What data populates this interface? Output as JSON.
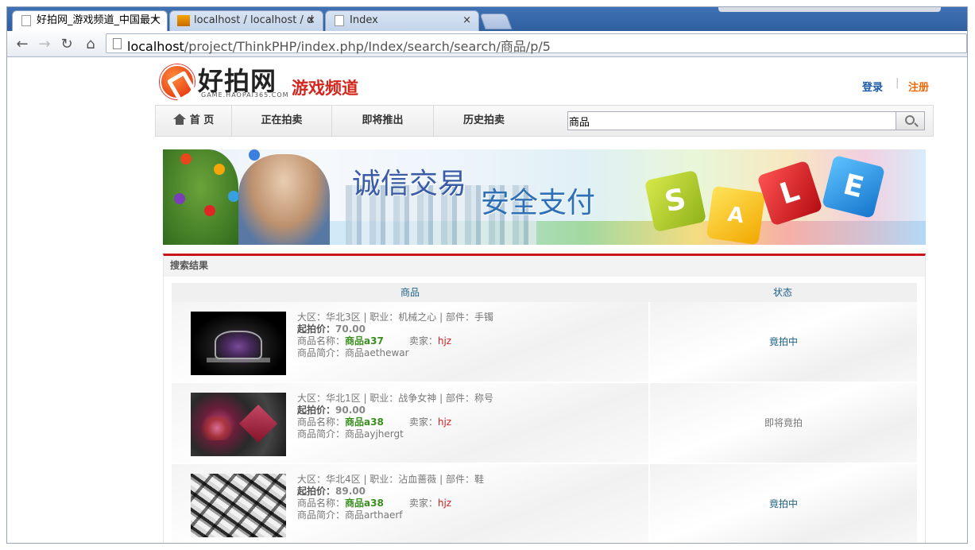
{
  "browser": {
    "tabs": [
      {
        "title": "好拍网_游戏频道_中国最大",
        "active": true,
        "icon": "page-icon"
      },
      {
        "title": "localhost / localhost / d",
        "active": false,
        "icon": "phpmyadmin-icon"
      },
      {
        "title": "Index",
        "active": false,
        "icon": "page-icon"
      }
    ],
    "close_glyph": "×",
    "url_host": "localhost",
    "url_path": "/project/ThinkPHP/index.php/Index/search/search/商品/p/5"
  },
  "header": {
    "logo_name": "好拍网",
    "logo_sub": "GAME.HAOPAI365.COM",
    "logo_channel": "游戏频道",
    "login": "登录",
    "separator": "|",
    "register": "注册"
  },
  "nav": {
    "items": [
      "首 页",
      "正在拍卖",
      "即将推出",
      "历史拍卖"
    ],
    "search_value": "商品"
  },
  "banner": {
    "slogan1": "诚信交易",
    "slogan2": "安全支付",
    "cubes": [
      "S",
      "A",
      "L",
      "E"
    ]
  },
  "results": {
    "title": "搜索结果",
    "headers": {
      "goods": "商品",
      "status": "状态"
    },
    "rows": [
      {
        "region_line": "大区：华北3区 | 职业：机械之心 | 部件：手镯",
        "price_label": "起拍价：",
        "price": "70.00",
        "name_label": "商品名称：",
        "name": "商品a37",
        "seller_label": "卖家：",
        "seller": "hjz",
        "intro_label": "商品简介：",
        "intro": "商品aethewar",
        "status": "竟拍中",
        "status_type": "active"
      },
      {
        "region_line": "大区：华北1区 | 职业：战争女神 | 部件：称号",
        "price_label": "起拍价：",
        "price": "90.00",
        "name_label": "商品名称：",
        "name": "商品a38",
        "seller_label": "卖家：",
        "seller": "hjz",
        "intro_label": "商品简介：",
        "intro": "商品ayjhergt",
        "status": "即将竟拍",
        "status_type": "soon"
      },
      {
        "region_line": "大区：华北4区 | 职业：沾血蔷薇 | 部件：鞋",
        "price_label": "起拍价：",
        "price": "89.00",
        "name_label": "商品名称：",
        "name": "商品a38",
        "seller_label": "卖家：",
        "seller": "hjz",
        "intro_label": "商品简介：",
        "intro": "商品arthaerf",
        "status": "竟拍中",
        "status_type": "active"
      }
    ]
  },
  "colors": {
    "accent_red": "#c9141c",
    "link_blue": "#1a5aa6",
    "register_orange": "#ec6a08",
    "name_green": "#3a8f1e",
    "status_blue": "#1b5f86"
  }
}
